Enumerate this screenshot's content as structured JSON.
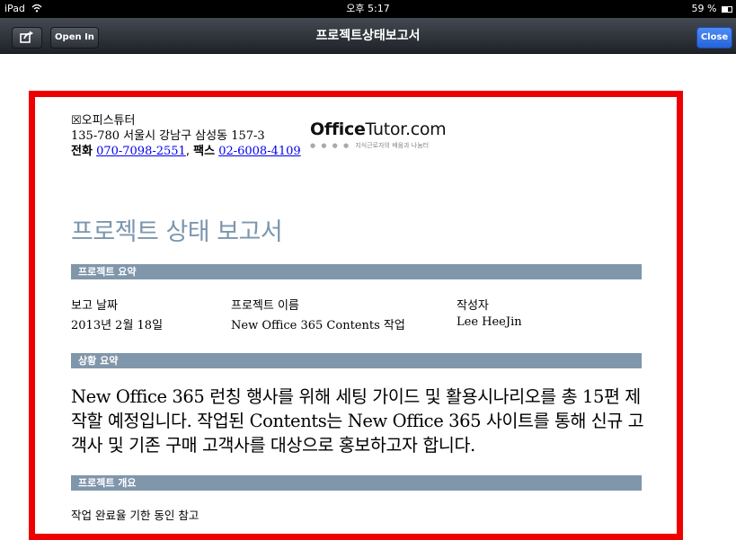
{
  "status_bar": {
    "device": "iPad",
    "wifi_icon": "wifi-icon",
    "time": "오후 5:17",
    "battery_percent_text": "59 %",
    "battery_level": 0.59
  },
  "nav_bar": {
    "share_icon": "share-icon",
    "open_in_label": "Open In",
    "title": "프로젝트상태보고서",
    "close_label": "Close"
  },
  "document": {
    "company": "☒오피스튜터",
    "address": "135-780 서울시 강남구 삼성동 157-3",
    "phone_label": "전화",
    "phone": "070-7098-2551",
    "fax_label": "팩스",
    "fax": "02-6008-4109",
    "logo_bold": "Office",
    "logo_rest": "Tutor.com",
    "logo_dots": "● ● ● ●",
    "logo_tagline": "지식근로자의 배움과 나눔터",
    "title": "프로젝트 상태 보고서",
    "section_summary": "프로젝트 요약",
    "report_date_label": "보고 날짜",
    "report_date": "2013년 2월 18일",
    "project_name_label": "프로젝트 이름",
    "project_name": "New Office 365 Contents 작업",
    "author_label": "작성자",
    "author": "Lee HeeJin",
    "section_status": "상황 요약",
    "status_summary": "New Office 365 런칭 행사를 위해 세팅 가이드 및 활용시나리오를 총 15편 제작할 예정입니다. 작업된 Contents는 New Office 365 사이트를 통해 신규 고객사 및 기존 구매 고객사를 대상으로 홍보하고자 합니다.",
    "section_overview": "프로젝트 개요",
    "overview_text": "작업 완료율 기한 동인 참고"
  },
  "colors": {
    "frame_border": "#ee0000",
    "section_bar": "#8096ab",
    "title_color": "#7b96ad",
    "close_button": "#2f6fe0"
  }
}
